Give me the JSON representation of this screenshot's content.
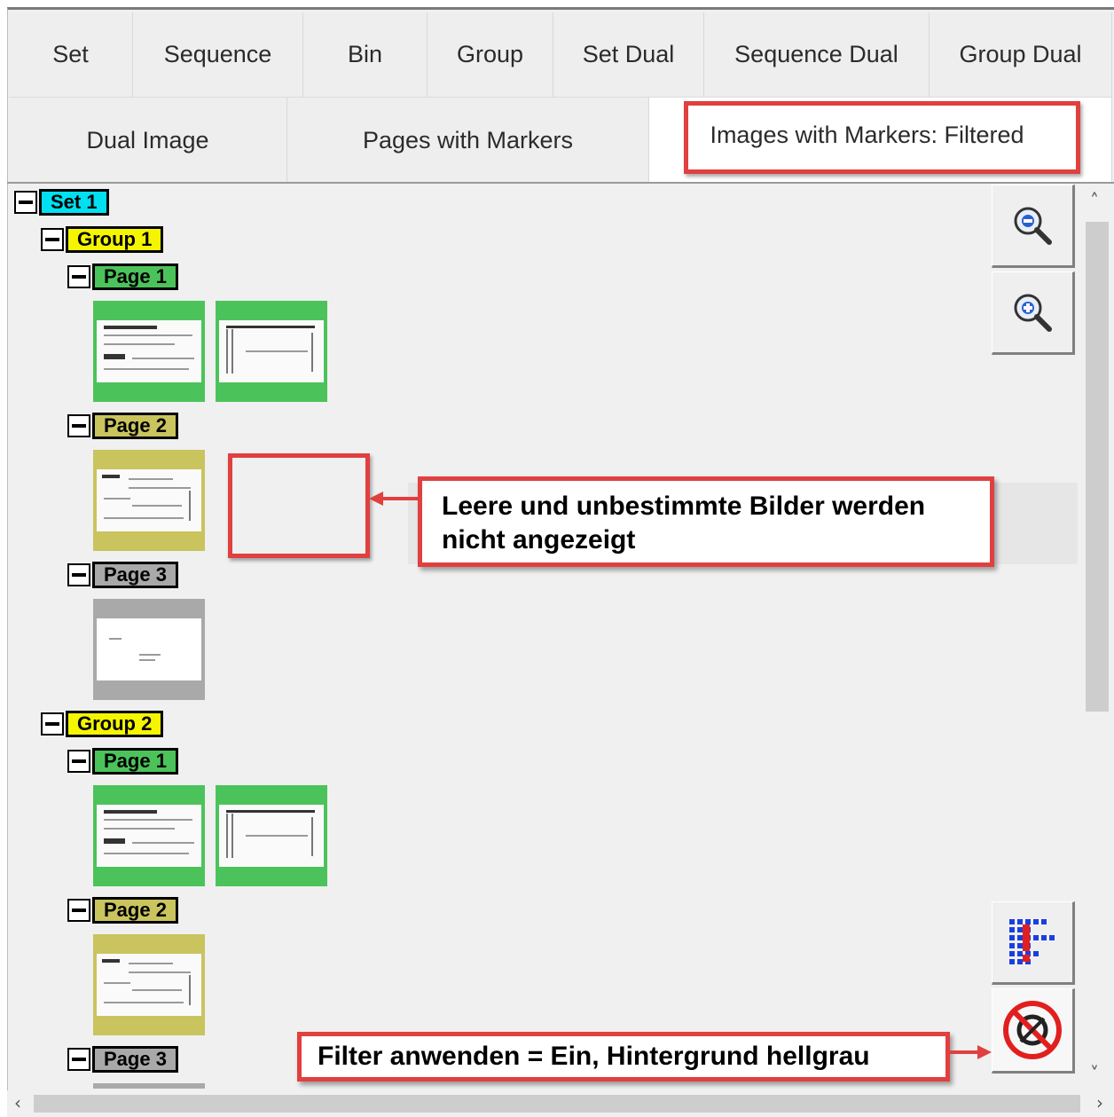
{
  "tabs": {
    "row1": [
      "Set",
      "Sequence",
      "Bin",
      "Group",
      "Set Dual",
      "Sequence Dual",
      "Group Dual"
    ],
    "row2": [
      "Dual Image",
      "Pages with Markers",
      "Images with Markers: Filtered"
    ]
  },
  "tree": {
    "set1": "Set 1",
    "group1": "Group 1",
    "group2": "Group 2",
    "page1": "Page 1",
    "page2": "Page 2",
    "page3": "Page 3"
  },
  "callouts": {
    "empty_images_line1": "Leere und unbestimmte Bilder werden",
    "empty_images_line2": "nicht angezeigt",
    "filter": "Filter anwenden = Ein, Hintergrund hellgrau"
  },
  "toolbar": {
    "zoom_out": "zoom-out-icon",
    "zoom_in": "zoom-in-icon",
    "marker_list": "marker-list-icon",
    "filter": "filter-icon"
  },
  "colors": {
    "set": "#00e0f0",
    "group": "#f5f500",
    "page1": "#4cc35a",
    "page2": "#c9c45e",
    "page3": "#a9a9a9",
    "annotation": "#e0403f"
  }
}
